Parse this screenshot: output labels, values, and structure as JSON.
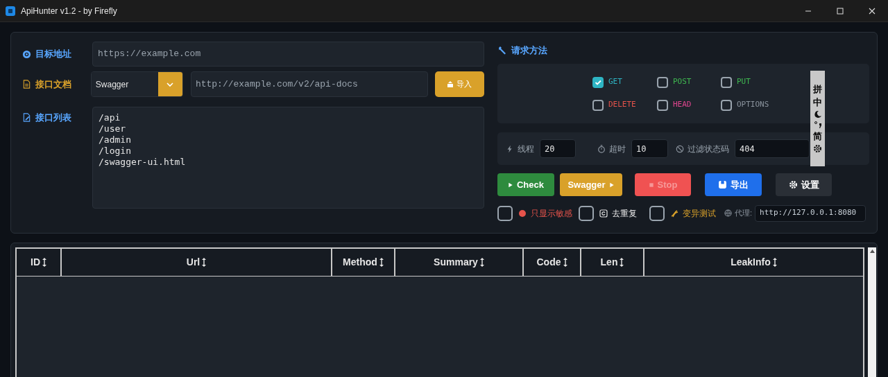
{
  "window": {
    "title": "ApiHunter v1.2 - by Firefly"
  },
  "target": {
    "label": "目标地址",
    "value": "https://example.com"
  },
  "doc": {
    "label": "接口文档",
    "type": "Swagger",
    "url": "http://example.com/v2/api-docs",
    "import_button": "导入"
  },
  "endpoints": {
    "label": "接口列表",
    "lines": [
      "/api",
      "/user",
      "/admin",
      "/login",
      "/swagger-ui.html"
    ]
  },
  "methods": {
    "title": "请求方法",
    "items": [
      {
        "label": "GET",
        "checked": true,
        "color": "#2eb5c4"
      },
      {
        "label": "POST",
        "checked": false,
        "color": "#3fb950"
      },
      {
        "label": "PUT",
        "checked": false,
        "color": "#3fb950"
      },
      {
        "label": "DELETE",
        "checked": false,
        "color": "#e5534b"
      },
      {
        "label": "HEAD",
        "checked": false,
        "color": "#e0468f"
      },
      {
        "label": "OPTIONS",
        "checked": false,
        "color": "#8b949e"
      }
    ]
  },
  "params": [
    {
      "kind": "threads",
      "label": "线程",
      "value": "20"
    },
    {
      "kind": "timeout",
      "label": "超时",
      "value": "10"
    },
    {
      "kind": "filter",
      "label": "过滤状态码",
      "value": "404"
    }
  ],
  "buttons": [
    {
      "kind": "check",
      "label": "Check",
      "disabled": false
    },
    {
      "kind": "swagger",
      "label": "Swagger",
      "disabled": false
    },
    {
      "kind": "stop",
      "label": "Stop",
      "disabled": true
    },
    {
      "kind": "export",
      "label": "导出",
      "disabled": false
    },
    {
      "kind": "settings",
      "label": "设置",
      "disabled": false
    }
  ],
  "options": [
    {
      "kind": "sensitive",
      "label": "只显示敏感",
      "checked": false
    },
    {
      "kind": "dedupe",
      "label": "去重复",
      "checked": false
    },
    {
      "kind": "mutation",
      "label": "变异测试",
      "checked": false
    }
  ],
  "proxy": {
    "label": "代理:",
    "value": "http://127.0.0.1:8080"
  },
  "table": {
    "columns": [
      "ID",
      "Url",
      "Method",
      "Summary",
      "Code",
      "Len",
      "LeakInfo"
    ]
  },
  "ime_toolbar": {
    "items": [
      {
        "kind": "text",
        "label": "拼"
      },
      {
        "kind": "text",
        "label": "中"
      },
      {
        "kind": "moon"
      },
      {
        "kind": "punct"
      },
      {
        "kind": "text",
        "label": "简"
      },
      {
        "kind": "gear"
      }
    ]
  }
}
